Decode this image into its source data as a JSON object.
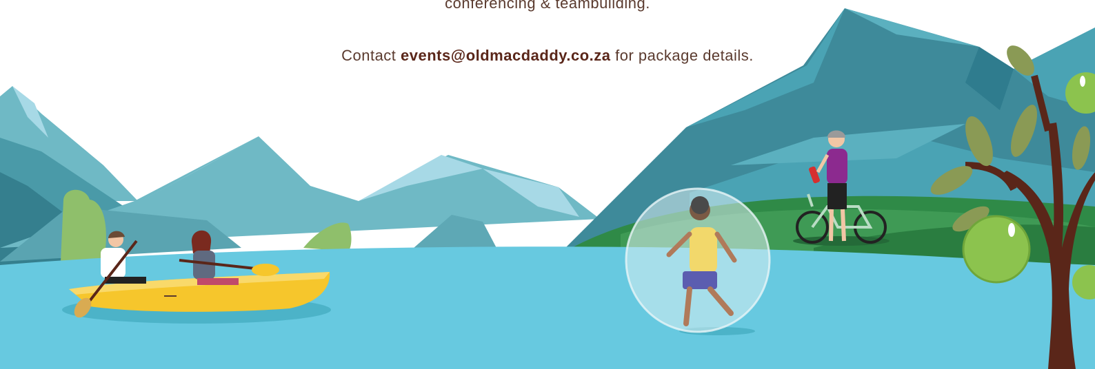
{
  "intro": {
    "line1": "conferencing & teambuilding."
  },
  "contact": {
    "prefix": "Contact ",
    "email": "events@oldmacdaddy.co.za",
    "suffix": " for package details."
  },
  "colors": {
    "water": "#67c9e0",
    "mountain_light": "#6fb9c5",
    "mountain_dark": "#3e8a9a",
    "grass": "#2f8a47",
    "kayak": "#f6c62c",
    "text": "#5a3a2e",
    "email": "#5a2619"
  },
  "icons": {
    "kayakers": "kayak-illustration",
    "zorb": "zorb-ball-illustration",
    "cyclist": "cyclist-illustration",
    "tree": "apple-tree-illustration"
  }
}
